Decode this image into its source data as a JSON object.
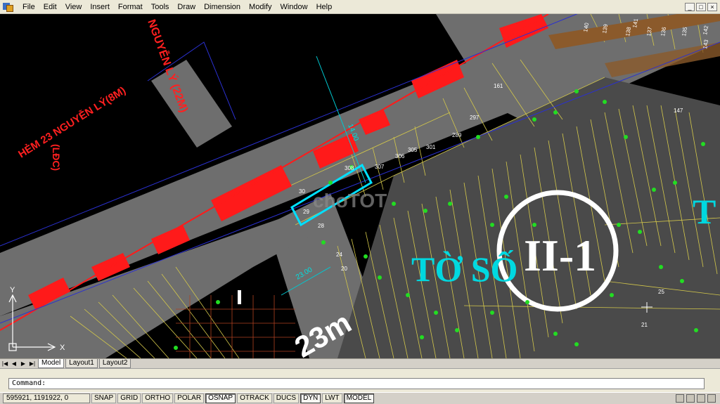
{
  "menu": {
    "items": [
      "File",
      "Edit",
      "View",
      "Insert",
      "Format",
      "Tools",
      "Draw",
      "Dimension",
      "Modify",
      "Window",
      "Help"
    ]
  },
  "window_controls": {
    "minimize": "_",
    "restore": "□",
    "close": "×"
  },
  "drawing": {
    "street_label_1": "HẺM 23 NGUYỄN LÝ(8M)",
    "street_label_2": "(LĐC)",
    "street_label_3": "NGUYỄN LÝ (22M)",
    "sheet_label": "TỜ SỐ",
    "sheet_number": "II-1",
    "big_letter": "T",
    "road_width": "23m",
    "dim_1": "23.00",
    "dim_2": "14.00",
    "watermark": "choTOT",
    "parcels": [
      "30",
      "29",
      "28",
      "308",
      "307",
      "306",
      "305",
      "301",
      "297",
      "289",
      "24",
      "20",
      "25",
      "21",
      "161",
      "147",
      "139",
      "138",
      "137",
      "136",
      "135",
      "140",
      "141",
      "142",
      "143"
    ],
    "ucs_x": "X",
    "ucs_y": "Y"
  },
  "layout_tabs": [
    "Model",
    "Layout1",
    "Layout2"
  ],
  "nav_buttons": [
    "|◀",
    "◀",
    "▶",
    "▶|"
  ],
  "command": {
    "prompt": "Command:"
  },
  "status": {
    "coords": "595921, 1191922, 0",
    "buttons": [
      "SNAP",
      "GRID",
      "ORTHO",
      "POLAR",
      "OSNAP",
      "OTRACK",
      "DUCS",
      "DYN",
      "LWT",
      "MODEL"
    ],
    "active": [
      "OSNAP",
      "DYN",
      "MODEL"
    ]
  }
}
